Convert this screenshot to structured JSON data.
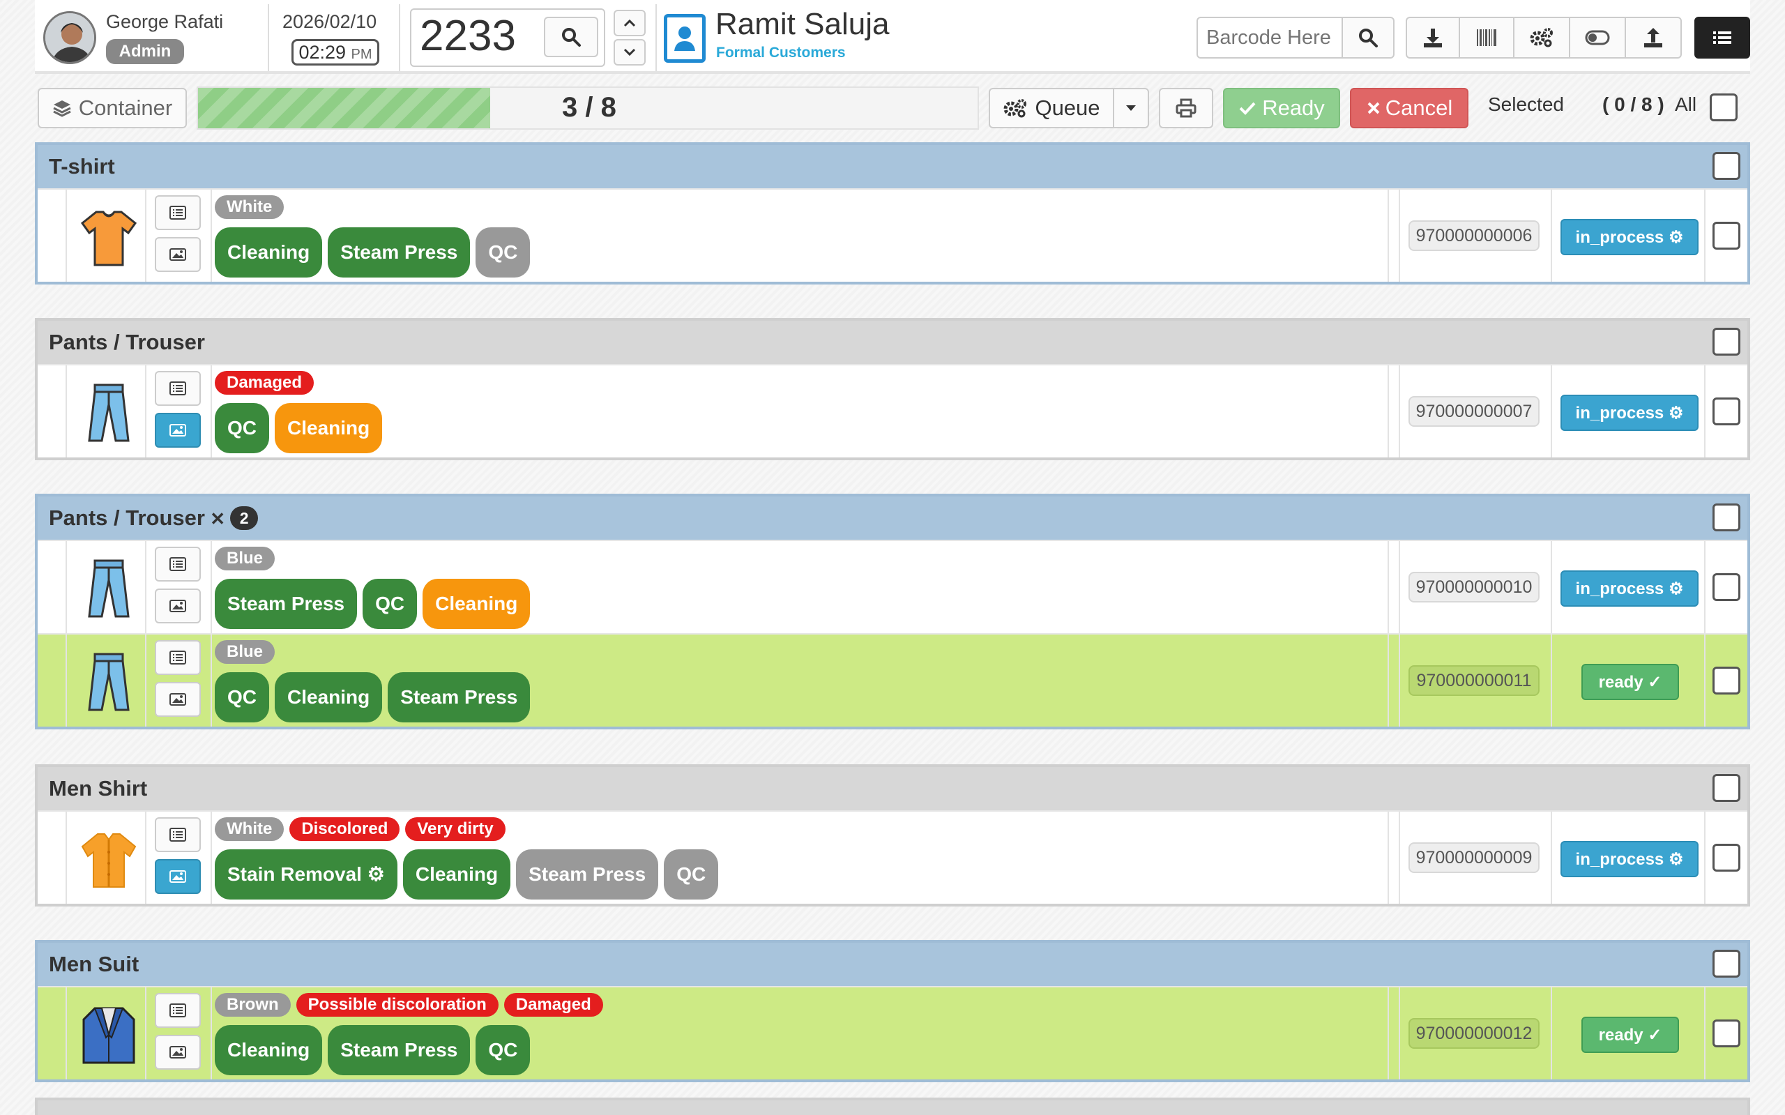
{
  "header": {
    "user_name": "George Rafati",
    "user_role": "Admin",
    "date": "2026/02/10",
    "time": "02:29",
    "time_suffix": "PM",
    "order_number": "2233",
    "customer_name": "Ramit Saluja",
    "customer_type": "Formal Customers",
    "barcode_placeholder": "Barcode Here"
  },
  "toolbar": {
    "container_label": "Container",
    "progress_text": "3 / 8",
    "progress_fraction": 0.375,
    "queue_label": "Queue",
    "ready_label": "Ready",
    "cancel_label": "Cancel",
    "selected_label": "Selected",
    "selected_count": "( 0 / 8 )",
    "all_label": "All"
  },
  "groups": [
    {
      "title": "T-shirt",
      "style": "blue",
      "count": "",
      "items": [
        {
          "icon": "tshirt-icon",
          "tags": [
            {
              "text": "White",
              "color": "grey"
            }
          ],
          "services": [
            {
              "text": "Cleaning",
              "color": "green"
            },
            {
              "text": "Steam Press",
              "color": "green"
            },
            {
              "text": "QC",
              "color": "grey"
            }
          ],
          "barcode": "970000000006",
          "status": "in_process",
          "ready": false,
          "image_active": false
        }
      ]
    },
    {
      "title": "Pants / Trouser",
      "style": "grey",
      "count": "",
      "items": [
        {
          "icon": "pants-icon",
          "tags": [
            {
              "text": "Damaged",
              "color": "red"
            }
          ],
          "services": [
            {
              "text": "QC",
              "color": "green"
            },
            {
              "text": "Cleaning",
              "color": "orange"
            }
          ],
          "barcode": "970000000007",
          "status": "in_process",
          "ready": false,
          "image_active": true
        }
      ]
    },
    {
      "title": "Pants / Trouser",
      "style": "blue",
      "count": "2",
      "items": [
        {
          "icon": "pants-icon",
          "tags": [
            {
              "text": "Blue",
              "color": "grey"
            }
          ],
          "services": [
            {
              "text": "Steam Press",
              "color": "green"
            },
            {
              "text": "QC",
              "color": "green"
            },
            {
              "text": "Cleaning",
              "color": "orange"
            }
          ],
          "barcode": "970000000010",
          "status": "in_process",
          "ready": false,
          "image_active": false
        },
        {
          "icon": "pants-icon",
          "tags": [
            {
              "text": "Blue",
              "color": "grey"
            }
          ],
          "services": [
            {
              "text": "QC",
              "color": "green"
            },
            {
              "text": "Cleaning",
              "color": "green"
            },
            {
              "text": "Steam Press",
              "color": "green"
            }
          ],
          "barcode": "970000000011",
          "status": "ready",
          "ready": true,
          "image_active": false
        }
      ]
    },
    {
      "title": "Men Shirt",
      "style": "grey",
      "count": "",
      "items": [
        {
          "icon": "shirt-icon",
          "tags": [
            {
              "text": "White",
              "color": "grey"
            },
            {
              "text": "Discolored",
              "color": "red"
            },
            {
              "text": "Very dirty",
              "color": "red"
            }
          ],
          "services": [
            {
              "text": "Stain Removal",
              "color": "green",
              "extra": "⚙"
            },
            {
              "text": "Cleaning",
              "color": "green"
            },
            {
              "text": "Steam Press",
              "color": "grey"
            },
            {
              "text": "QC",
              "color": "grey"
            }
          ],
          "barcode": "970000000009",
          "status": "in_process",
          "ready": false,
          "image_active": true
        }
      ]
    },
    {
      "title": "Men Suit",
      "style": "blue",
      "count": "",
      "items": [
        {
          "icon": "suit-icon",
          "tags": [
            {
              "text": "Brown",
              "color": "grey"
            },
            {
              "text": "Possible discoloration",
              "color": "red"
            },
            {
              "text": "Damaged",
              "color": "red"
            }
          ],
          "services": [
            {
              "text": "Cleaning",
              "color": "green"
            },
            {
              "text": "Steam Press",
              "color": "green"
            },
            {
              "text": "QC",
              "color": "green"
            }
          ],
          "barcode": "970000000012",
          "status": "ready",
          "ready": true,
          "image_active": false
        }
      ]
    }
  ],
  "colors": {
    "accent_blue": "#3ba4d0",
    "ready_green": "#5bb86f",
    "service_green": "#3a8a3c",
    "damage_red": "#e41e1e",
    "row_ready_bg": "#cdea85"
  }
}
